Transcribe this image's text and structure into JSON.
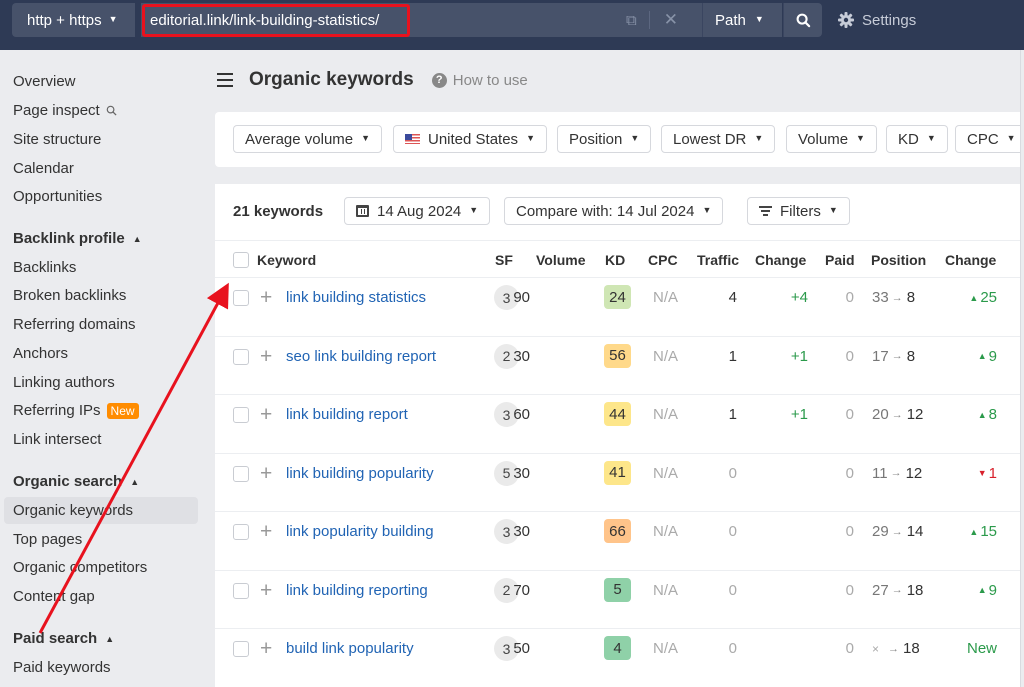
{
  "topbar": {
    "protocol_label": "http + https",
    "url_value": "editorial.link/link-building-statistics/",
    "mode_label": "Path",
    "settings_label": "Settings"
  },
  "sidebar": {
    "items": [
      {
        "label": "Overview"
      },
      {
        "label": "Page inspect"
      },
      {
        "label": "Site structure"
      },
      {
        "label": "Calendar"
      },
      {
        "label": "Opportunities"
      }
    ],
    "sections": [
      {
        "title": "Backlink profile",
        "items": [
          {
            "label": "Backlinks"
          },
          {
            "label": "Broken backlinks"
          },
          {
            "label": "Referring domains"
          },
          {
            "label": "Anchors"
          },
          {
            "label": "Linking authors"
          },
          {
            "label": "Referring IPs",
            "badge": "New"
          },
          {
            "label": "Link intersect"
          }
        ]
      },
      {
        "title": "Organic search",
        "items": [
          {
            "label": "Organic keywords",
            "active": true
          },
          {
            "label": "Top pages"
          },
          {
            "label": "Organic competitors"
          },
          {
            "label": "Content gap"
          }
        ]
      },
      {
        "title": "Paid search",
        "items": [
          {
            "label": "Paid keywords"
          }
        ]
      }
    ]
  },
  "header": {
    "title": "Organic keywords",
    "help_label": "How to use"
  },
  "filters": [
    {
      "label": "Average volume"
    },
    {
      "label": "United States"
    },
    {
      "label": "Position"
    },
    {
      "label": "Lowest DR"
    },
    {
      "label": "Volume"
    },
    {
      "label": "KD"
    },
    {
      "label": "CPC"
    }
  ],
  "toolbar": {
    "count_label": "21 keywords",
    "date_label": "14 Aug 2024",
    "compare_label": "Compare with: 14 Jul 2024",
    "filters_label": "Filters"
  },
  "table": {
    "columns": [
      "Keyword",
      "SF",
      "Volume",
      "KD",
      "CPC",
      "Traffic",
      "Change",
      "Paid",
      "Position",
      "Change"
    ],
    "rows": [
      {
        "keyword": "link building statistics",
        "sf": "3",
        "volume": "90",
        "kd": "24",
        "kd_color": "#cfe6b4",
        "cpc": "N/A",
        "traffic": "4",
        "traffic_change": "+4",
        "paid": "0",
        "pos_from": "33",
        "pos_to": "8",
        "pos_change": "25",
        "pos_dir": "up"
      },
      {
        "keyword": "seo link building report",
        "sf": "2",
        "volume": "30",
        "kd": "56",
        "kd_color": "#ffd98a",
        "cpc": "N/A",
        "traffic": "1",
        "traffic_change": "+1",
        "paid": "0",
        "pos_from": "17",
        "pos_to": "8",
        "pos_change": "9",
        "pos_dir": "up"
      },
      {
        "keyword": "link building report",
        "sf": "3",
        "volume": "60",
        "kd": "44",
        "kd_color": "#fde68a",
        "cpc": "N/A",
        "traffic": "1",
        "traffic_change": "+1",
        "paid": "0",
        "pos_from": "20",
        "pos_to": "12",
        "pos_change": "8",
        "pos_dir": "up"
      },
      {
        "keyword": "link building popularity",
        "sf": "5",
        "volume": "30",
        "kd": "41",
        "kd_color": "#fde68a",
        "cpc": "N/A",
        "traffic": "0",
        "traffic_change": "",
        "paid": "0",
        "pos_from": "11",
        "pos_to": "12",
        "pos_change": "1",
        "pos_dir": "down"
      },
      {
        "keyword": "link popularity building",
        "sf": "3",
        "volume": "30",
        "kd": "66",
        "kd_color": "#ffc48a",
        "cpc": "N/A",
        "traffic": "0",
        "traffic_change": "",
        "paid": "0",
        "pos_from": "29",
        "pos_to": "14",
        "pos_change": "15",
        "pos_dir": "up"
      },
      {
        "keyword": "link building reporting",
        "sf": "2",
        "volume": "70",
        "kd": "5",
        "kd_color": "#8fd1a8",
        "cpc": "N/A",
        "traffic": "0",
        "traffic_change": "",
        "paid": "0",
        "pos_from": "27",
        "pos_to": "18",
        "pos_change": "9",
        "pos_dir": "up"
      },
      {
        "keyword": "build link popularity",
        "sf": "3",
        "volume": "50",
        "kd": "4",
        "kd_color": "#8fd1a8",
        "cpc": "N/A",
        "traffic": "0",
        "traffic_change": "",
        "paid": "0",
        "pos_from": "×",
        "pos_to": "18",
        "pos_change": "New",
        "pos_dir": "new"
      }
    ]
  },
  "annotation": {
    "color": "#e8121e"
  }
}
